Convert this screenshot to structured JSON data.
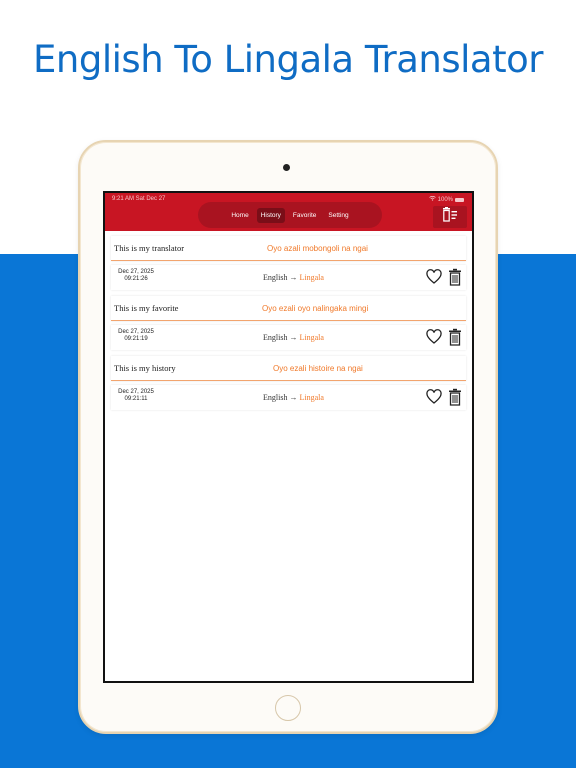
{
  "headline": "English To Lingala Translator",
  "status": {
    "time": "9:21 AM   Sat Dec 27",
    "battery": "100%"
  },
  "nav": {
    "tabs": [
      "Home",
      "History",
      "Favorite",
      "Setting"
    ],
    "active": "History"
  },
  "colors": {
    "topbar": "#c81523",
    "accent": "#f0792a",
    "background_blue": "#0a76d6",
    "headline": "#0f6cc4"
  },
  "icons": {
    "clear_all": "trash-list-icon",
    "favorite": "heart-icon",
    "delete": "trash-icon"
  },
  "history": [
    {
      "source": "This is my translator",
      "translation": "Oyo azali mobongoli na ngai",
      "date": "Dec 27, 2025",
      "time": "09:21:26",
      "from": "English",
      "arrow": "→",
      "to": "Lingala"
    },
    {
      "source": "This is my favorite",
      "translation": "Oyo ezali oyo nalingaka mingi",
      "date": "Dec 27, 2025",
      "time": "09:21:19",
      "from": "English",
      "arrow": "→",
      "to": "Lingala"
    },
    {
      "source": "This is my history",
      "translation": "Oyo ezali histoire na ngai",
      "date": "Dec 27, 2025",
      "time": "09:21:11",
      "from": "English",
      "arrow": "→",
      "to": "Lingala"
    }
  ]
}
